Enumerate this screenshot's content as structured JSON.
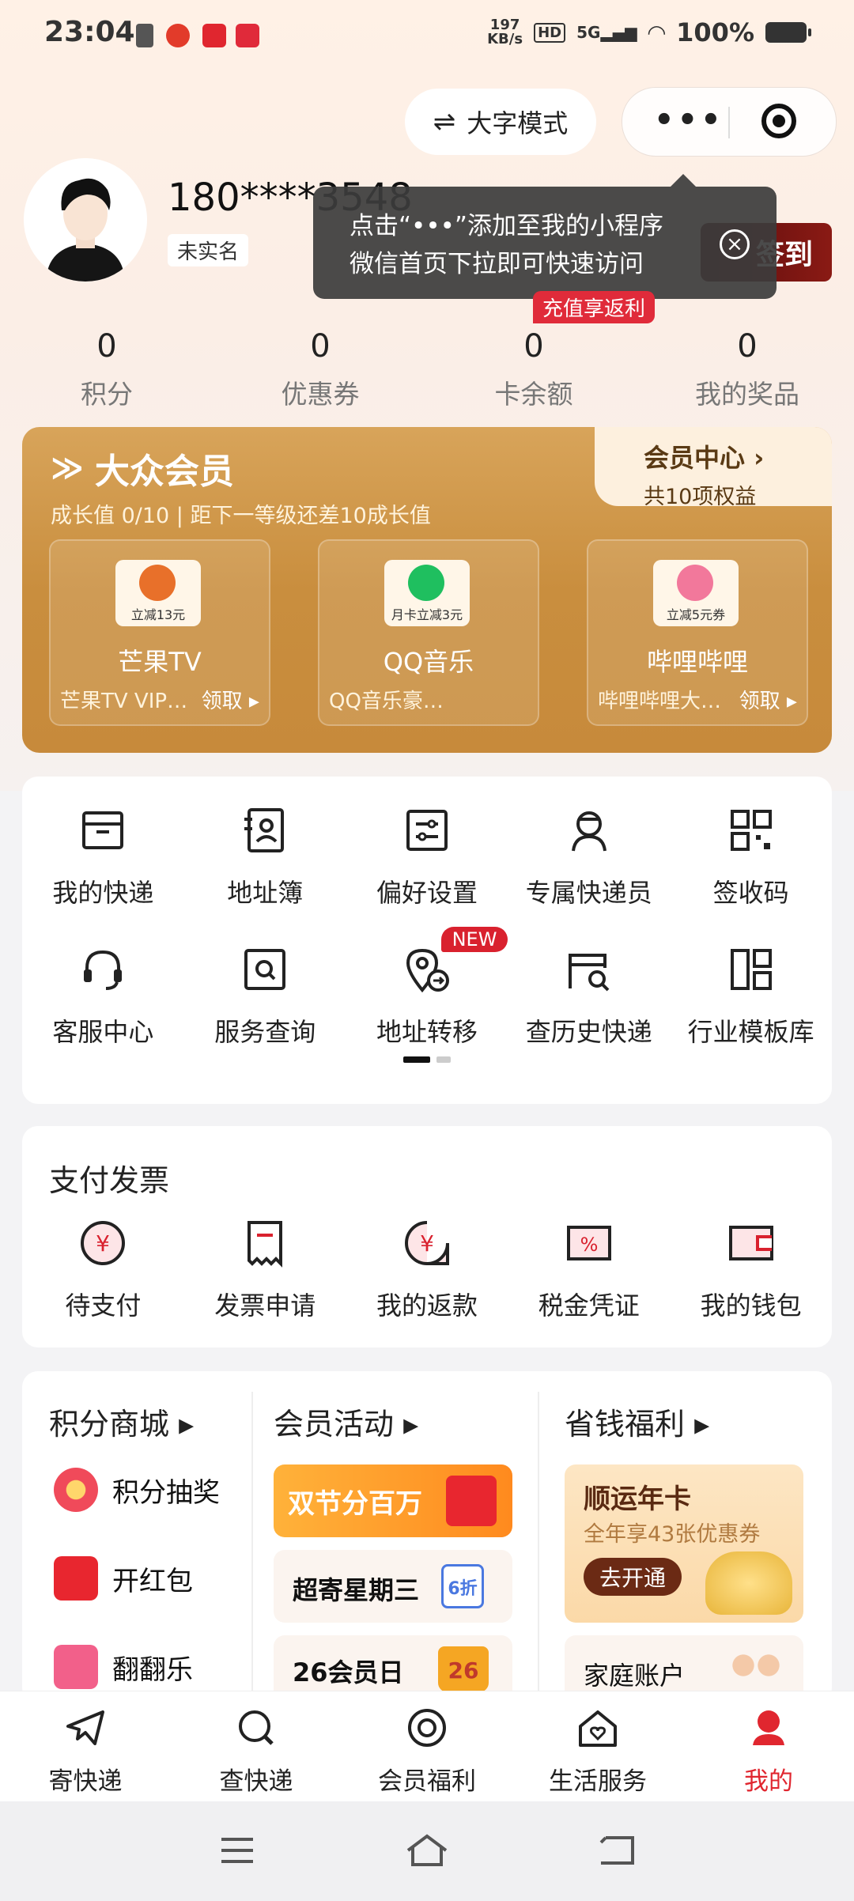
{
  "status_bar": {
    "time": "23:04",
    "net_speed_value": "197",
    "net_speed_unit": "KB/s",
    "hd": "HD",
    "network": "5G",
    "battery": "100%"
  },
  "top_actions": {
    "big_font_mode": "大字模式",
    "big_font_icon": "⇌",
    "more_icon": "•••"
  },
  "profile": {
    "phone": "180****3548",
    "real_name_status": "未实名",
    "sign_in": "签到",
    "tooltip_line1": "点击“•••”添加至我的小程序",
    "tooltip_line2": "微信首页下拉即可快速访问",
    "rebate_badge": "充值享返利"
  },
  "stats": [
    {
      "value": "0",
      "label": "积分"
    },
    {
      "value": "0",
      "label": "优惠券"
    },
    {
      "value": "0",
      "label": "卡余额"
    },
    {
      "value": "0",
      "label": "我的奖品"
    }
  ],
  "member": {
    "title": "大众会员",
    "growth": "成长值 0/10 | 距下一等级还差10成长值",
    "center_label": "会员中心",
    "center_arrow": "›",
    "center_sub": "共10项权益",
    "perks": [
      {
        "coupon": "立减13元",
        "name": "芒果TV",
        "desc": "芒果TV VIP…",
        "claim": "领取 ▸",
        "color": "#e8702a"
      },
      {
        "coupon": "月卡立减3元",
        "name": "QQ音乐",
        "desc": "QQ音乐豪…",
        "claim": "",
        "color": "#1fbf5f"
      },
      {
        "coupon": "立减5元券",
        "name": "哔哩哔哩",
        "desc": "哔哩哔哩大…",
        "claim": "领取 ▸",
        "color": "#f2789b"
      }
    ]
  },
  "tools": {
    "row1": [
      {
        "label": "我的快递",
        "icon": "box-icon"
      },
      {
        "label": "地址簿",
        "icon": "contact-book-icon"
      },
      {
        "label": "偏好设置",
        "icon": "settings-sliders-icon"
      },
      {
        "label": "专属快递员",
        "icon": "courier-icon"
      },
      {
        "label": "签收码",
        "icon": "qr-code-icon"
      }
    ],
    "row2": [
      {
        "label": "客服中心",
        "icon": "headset-icon"
      },
      {
        "label": "服务查询",
        "icon": "search-doc-icon"
      },
      {
        "label": "地址转移",
        "icon": "location-transfer-icon"
      },
      {
        "label": "查历史快递",
        "icon": "history-search-icon"
      },
      {
        "label": "行业模板库",
        "icon": "template-grid-icon"
      }
    ],
    "new_tag": "NEW"
  },
  "payment": {
    "title": "支付发票",
    "items": [
      {
        "label": "待支付",
        "icon": "yuan-pending-icon"
      },
      {
        "label": "发票申请",
        "icon": "invoice-icon"
      },
      {
        "label": "我的返款",
        "icon": "refund-icon"
      },
      {
        "label": "税金凭证",
        "icon": "tax-voucher-icon"
      },
      {
        "label": "我的钱包",
        "icon": "wallet-icon"
      }
    ]
  },
  "mall": {
    "title": "积分商城 ▸",
    "items": [
      {
        "label": "积分抽奖",
        "color": "#f04a5a"
      },
      {
        "label": "开红包",
        "color": "#e8262f"
      },
      {
        "label": "翻翻乐",
        "color": "#f2608a"
      }
    ]
  },
  "activities": {
    "title": "会员活动 ▸",
    "banner": "双节分百万",
    "weekly": "超寄星期三",
    "weekly_badge": "6折",
    "member_day": "26会员日",
    "member_day_badge": "26"
  },
  "savings": {
    "title": "省钱福利 ▸",
    "card_title": "顺运年卡",
    "card_sub": "全年享43张优惠券",
    "card_btn": "去开通",
    "family": "家庭账户"
  },
  "tabbar": [
    {
      "label": "寄快递",
      "icon": "send-plane-icon"
    },
    {
      "label": "查快递",
      "icon": "search-icon"
    },
    {
      "label": "会员福利",
      "icon": "member-target-icon"
    },
    {
      "label": "生活服务",
      "icon": "home-heart-icon"
    },
    {
      "label": "我的",
      "icon": "profile-icon"
    }
  ]
}
